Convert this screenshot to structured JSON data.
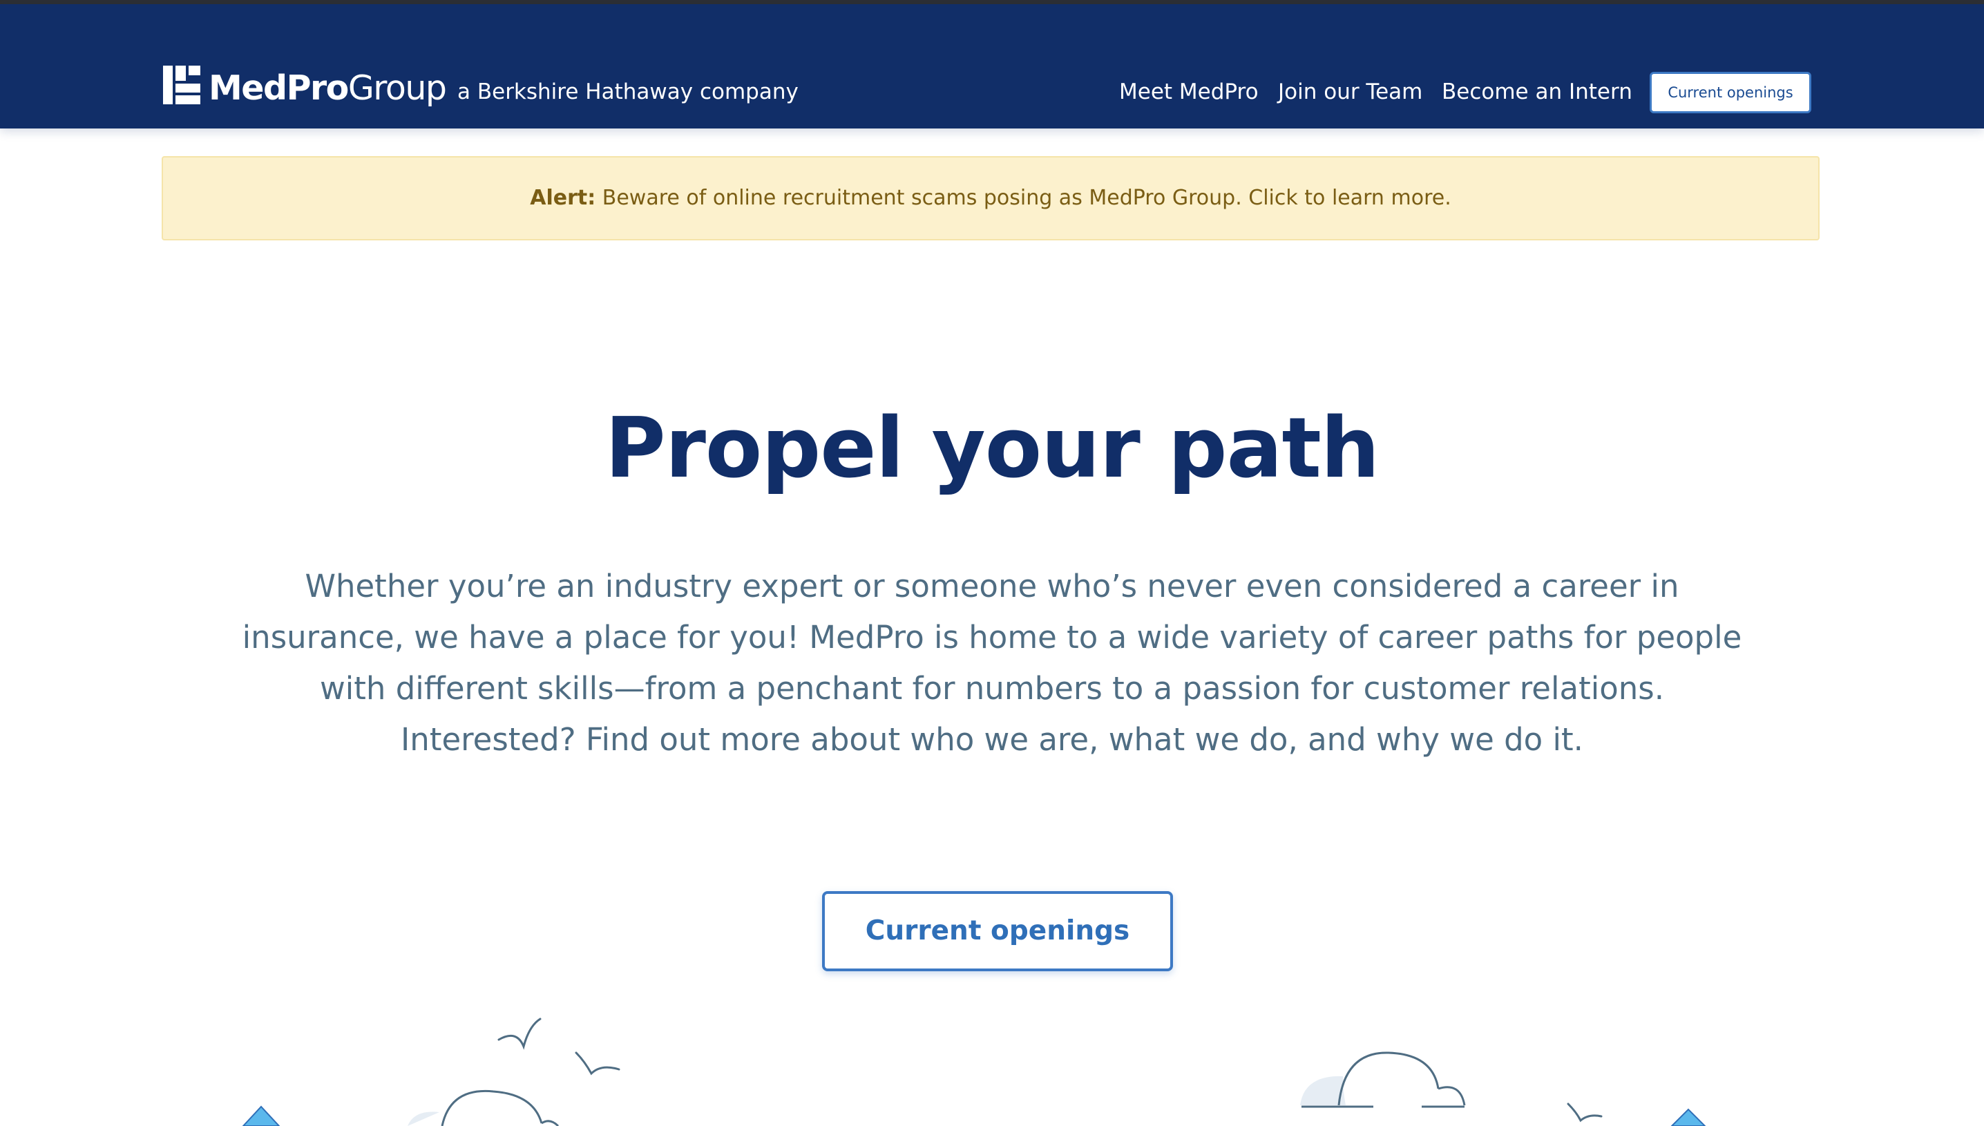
{
  "header": {
    "logo_bold": "MedPro",
    "logo_light": "Group",
    "tagline": "a Berkshire Hathaway company",
    "nav": [
      {
        "label": "Meet MedPro"
      },
      {
        "label": "Join our Team"
      },
      {
        "label": "Become an Intern"
      }
    ],
    "cta_label": "Current openings"
  },
  "alert": {
    "prefix": "Alert:",
    "message": " Beware of online recruitment scams posing as MedPro Group. Click to learn more."
  },
  "hero": {
    "title": "Propel your path",
    "body": "Whether you’re an industry expert or someone who’s never even considered a career in insurance, we have a place for you! MedPro is home to a wide variety of career paths for people with different skills—from a penchant for numbers to a passion for customer relations. Interested? Find out more about who we are, what we do, and why we do it.",
    "cta_label": "Current openings"
  },
  "colors": {
    "header_bg": "#112e68",
    "accent": "#3d79c4",
    "alert_bg": "#fcf1cd",
    "alert_text": "#7a5d14",
    "body_text": "#4f6d83"
  },
  "icons": [
    "medpro-logo-icon",
    "bird-icon",
    "cloud-icon",
    "hot-air-balloon-icon"
  ]
}
